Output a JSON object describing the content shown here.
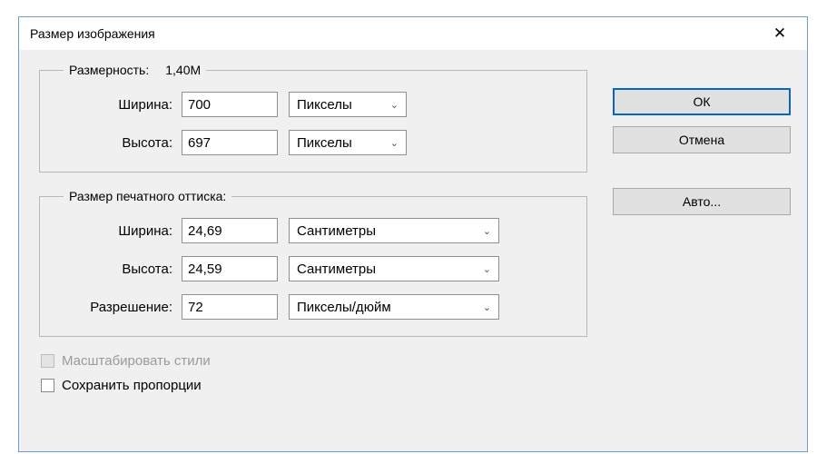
{
  "title": "Размер изображения",
  "close_glyph": "✕",
  "buttons": {
    "ok": "ОК",
    "cancel": "Отмена",
    "auto": "Авто..."
  },
  "pixel_dimensions": {
    "legend_label": "Размерность:",
    "legend_value": "1,40M",
    "width_label": "Ширина:",
    "width_value": "700",
    "width_unit": "Пикселы",
    "height_label": "Высота:",
    "height_value": "697",
    "height_unit": "Пикселы"
  },
  "document_size": {
    "legend": "Размер печатного оттиска:",
    "width_label": "Ширина:",
    "width_value": "24,69",
    "width_unit": "Сантиметры",
    "height_label": "Высота:",
    "height_value": "24,59",
    "height_unit": "Сантиметры",
    "resolution_label": "Разрешение:",
    "resolution_value": "72",
    "resolution_unit": "Пикселы/дюйм"
  },
  "options": {
    "scale_styles": "Масштабировать стили",
    "constrain_proportions": "Сохранить пропорции"
  },
  "icons": {
    "chevron_down": "⌄"
  }
}
